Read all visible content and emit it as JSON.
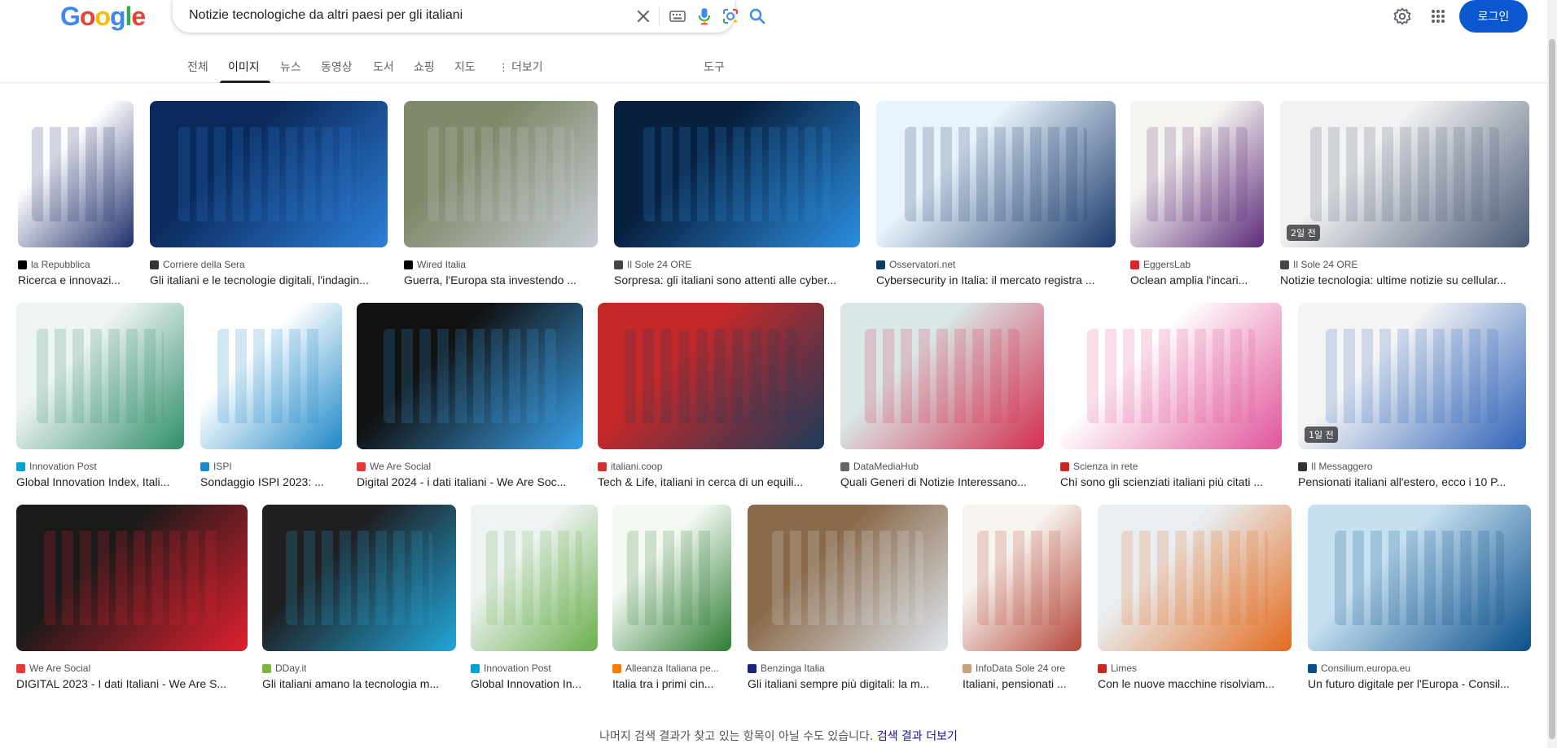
{
  "header": {
    "logo_letters": [
      "G",
      "o",
      "o",
      "g",
      "l",
      "e"
    ],
    "logo_colors": [
      "#4285f4",
      "#ea4335",
      "#fbbc05",
      "#4285f4",
      "#34a853",
      "#ea4335"
    ],
    "search_value": "Notizie tecnologiche da altri paesi per gli italiani",
    "login_label": "로그인"
  },
  "tabs": {
    "all": "전체",
    "images": "이미지",
    "news": "뉴스",
    "videos": "동영상",
    "books": "도서",
    "shopping": "쇼핑",
    "maps": "지도",
    "more": "더보기",
    "tools": "도구"
  },
  "results": [
    {
      "source": "la Repubblica",
      "title": "Ricerca e innovazi...",
      "fav": "#000000",
      "thumb_colors": [
        "#ffffff",
        "#1f2f6b"
      ]
    },
    {
      "source": "Corriere della Sera",
      "title": "Gli italiani e le tecnologie digitali, l'indagin...",
      "fav": "#333333",
      "thumb_colors": [
        "#0b2a5c",
        "#2d7fd8"
      ]
    },
    {
      "source": "Wired Italia",
      "title": "Guerra, l'Europa sta investendo ...",
      "fav": "#000000",
      "thumb_colors": [
        "#7f8a6a",
        "#c7cdd6"
      ]
    },
    {
      "source": "Il Sole 24 ORE",
      "title": "Sorpresa: gli italiani sono attenti alle cyber...",
      "fav": "#444444",
      "thumb_colors": [
        "#08203f",
        "#2c8fe0"
      ]
    },
    {
      "source": "Osservatori.net",
      "title": "Cybersecurity in Italia: il mercato registra ...",
      "fav": "#0b3a63",
      "thumb_colors": [
        "#e8f3fb",
        "#1a3a6b"
      ]
    },
    {
      "source": "EggersLab",
      "title": "Oclean amplia l'incari...",
      "fav": "#d62828",
      "thumb_colors": [
        "#f6f4f0",
        "#5c2b7a"
      ]
    },
    {
      "source": "Il Sole 24 ORE",
      "title": "Notizie tecnologia: ultime notizie su cellular...",
      "fav": "#444444",
      "thumb_colors": [
        "#f2f2f2",
        "#4a5a75"
      ],
      "badge": "2일 전"
    },
    {
      "source": "Innovation Post",
      "title": "Global Innovation Index, Itali...",
      "fav": "#00a3cc",
      "thumb_colors": [
        "#eef3f3",
        "#2f8f6a"
      ]
    },
    {
      "source": "ISPI",
      "title": "Sondaggio ISPI 2023: ...",
      "fav": "#1e88c8",
      "thumb_colors": [
        "#ffffff",
        "#1e88c8"
      ]
    },
    {
      "source": "We Are Social",
      "title": "Digital 2024 - i dati italiani - We Are Soc...",
      "fav": "#e53935",
      "thumb_colors": [
        "#111111",
        "#3aa0e8"
      ]
    },
    {
      "source": "italiani.coop",
      "title": "Tech & Life, italiani in cerca di un equili...",
      "fav": "#d32f2f",
      "thumb_colors": [
        "#c62828",
        "#1d3b5a"
      ]
    },
    {
      "source": "DataMediaHub",
      "title": "Quali Generi di Notizie Interessano...",
      "fav": "#666666",
      "thumb_colors": [
        "#d9e7e7",
        "#d32f4f"
      ]
    },
    {
      "source": "Scienza in rete",
      "title": "Chi sono gli scienziati italiani più citati ...",
      "fav": "#c62828",
      "thumb_colors": [
        "#ffffff",
        "#e0559a"
      ]
    },
    {
      "source": "Il Messaggero",
      "title": "Pensionati italiani all'estero, ecco i 10 P...",
      "fav": "#333333",
      "thumb_colors": [
        "#f5f5f5",
        "#2f63b8"
      ],
      "badge": "1일 전"
    },
    {
      "source": "We Are Social",
      "title": "DIGITAL 2023 - I dati Italiani - We Are S...",
      "fav": "#e53935",
      "thumb_colors": [
        "#1a1a1a",
        "#e0202e"
      ]
    },
    {
      "source": "DDay.it",
      "title": "Gli italiani amano la tecnologia m...",
      "fav": "#7cb342",
      "thumb_colors": [
        "#1f1f22",
        "#22a6d8"
      ]
    },
    {
      "source": "Innovation Post",
      "title": "Global Innovation In...",
      "fav": "#00a3cc",
      "thumb_colors": [
        "#eef3f3",
        "#6ab04c"
      ]
    },
    {
      "source": "Alleanza Italiana pe...",
      "title": "Italia tra i primi cin...",
      "fav": "#f57c00",
      "thumb_colors": [
        "#f3f8f3",
        "#2e7d32"
      ]
    },
    {
      "source": "Benzinga Italia",
      "title": "Gli italiani sempre più digitali: la m...",
      "fav": "#1a237e",
      "thumb_colors": [
        "#8a6a4a",
        "#dfe6ee"
      ]
    },
    {
      "source": "InfoData Sole 24 ore",
      "title": "Italiani, pensionati ...",
      "fav": "#c9a27c",
      "thumb_colors": [
        "#f7f3ee",
        "#b5483a"
      ]
    },
    {
      "source": "Limes",
      "title": "Con le nuove macchine risolviam...",
      "fav": "#c62828",
      "thumb_colors": [
        "#e9eef2",
        "#e36b1e"
      ]
    },
    {
      "source": "Consilium.europa.eu",
      "title": "Un futuro digitale per l'Europa - Consil...",
      "fav": "#0b4f8a",
      "thumb_colors": [
        "#c6e0f0",
        "#0b4f8a"
      ]
    }
  ],
  "footer": {
    "text": "나머지 검색 결과가 찾고 있는 항목이 아닐 수도 있습니다.",
    "link": "검색 결과 더보기"
  }
}
